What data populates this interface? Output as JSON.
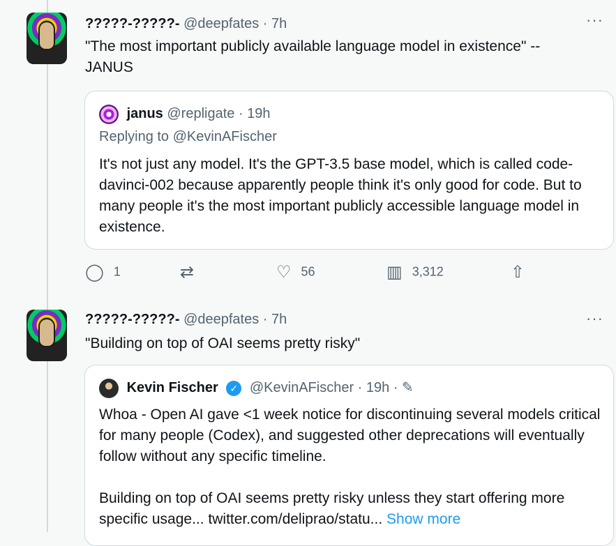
{
  "tweets": [
    {
      "author_name": "?????-?????-",
      "handle": "@deepfates",
      "time": "· 7h",
      "more": "···",
      "text": "\"The most important publicly available language model in existence\" --\nJANUS",
      "quote": {
        "author_name": "janus",
        "handle": "@repligate",
        "time": "· 19h",
        "reply_to": "Replying to @KevinAFischer",
        "text": "It's not just any model. It's the GPT-3.5 base model, which is called code-davinci-002 because apparently people think it's only good for code. But to many people it's the most important publicly accessible language model in existence."
      },
      "actions": {
        "replies": "1",
        "likes": "56",
        "views": "3,312"
      }
    },
    {
      "author_name": "?????-?????-",
      "handle": "@deepfates",
      "time": "· 7h",
      "more": "···",
      "text": "\"Building on top of OAI seems pretty risky\"",
      "quote": {
        "author_name": "Kevin Fischer",
        "handle": "@KevinAFischer",
        "time": "· 19h ·",
        "text_p1": "Whoa - Open AI gave <1 week notice for discontinuing several models critical for many people (Codex), and suggested other deprecations will eventually follow without any specific timeline.",
        "text_p2": "Building on top of OAI seems pretty risky unless they start offering more specific usage... twitter.com/deliprao/statu...",
        "show_more": "Show more"
      }
    }
  ],
  "icons": {
    "reply": "reply-icon",
    "retweet": "retweet-icon",
    "like": "heart-icon",
    "views": "views-icon",
    "share": "share-icon",
    "verified": "verified-icon",
    "edit": "pencil-icon"
  },
  "colors": {
    "accent": "#1d9bf0",
    "muted": "#536471",
    "border": "#cfd9de"
  }
}
